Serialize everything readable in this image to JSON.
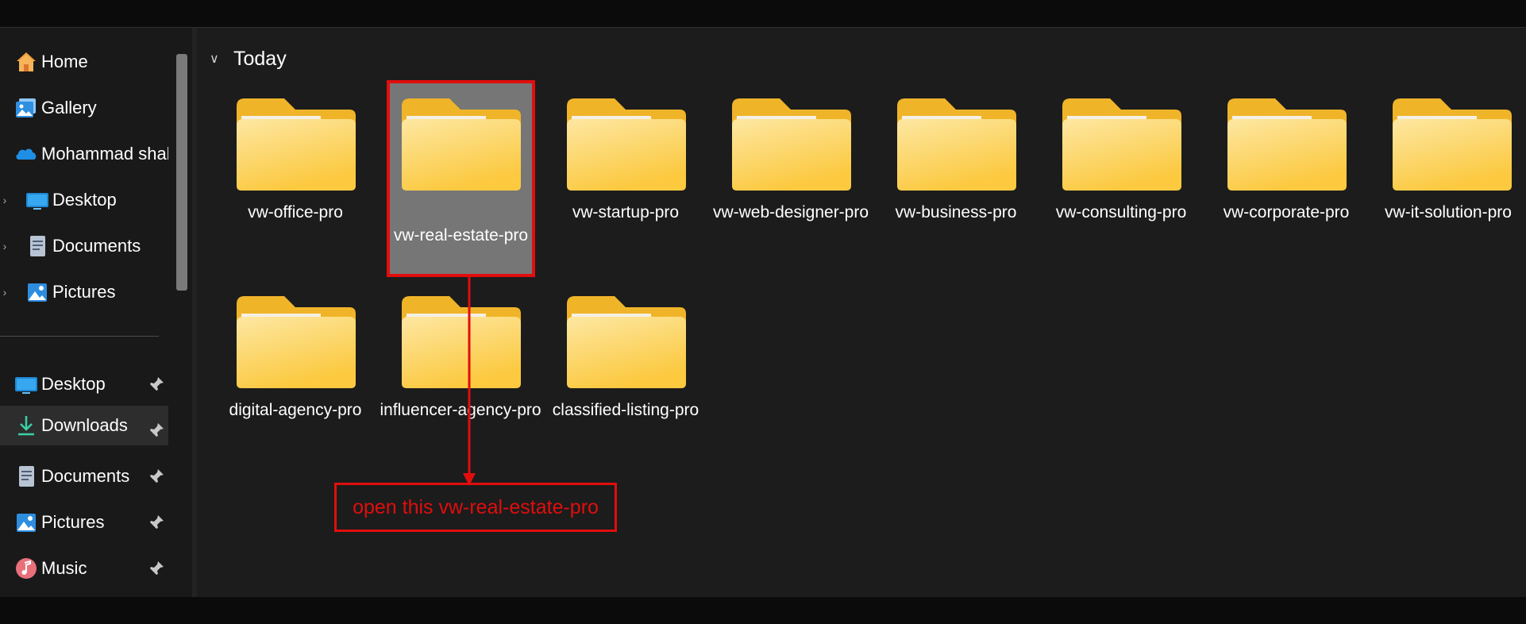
{
  "sidebar": {
    "items": [
      {
        "label": "Home",
        "icon": "home-icon",
        "selected": false,
        "pinned": false,
        "expandable": false
      },
      {
        "label": "Gallery",
        "icon": "gallery-icon",
        "selected": false,
        "pinned": false,
        "expandable": false
      },
      {
        "label": "Mohammad shal",
        "icon": "onedrive-icon",
        "selected": false,
        "pinned": false,
        "expandable": false
      },
      {
        "label": "Desktop",
        "icon": "desktop-icon",
        "selected": false,
        "pinned": false,
        "expandable": true
      },
      {
        "label": "Documents",
        "icon": "documents-icon",
        "selected": false,
        "pinned": false,
        "expandable": true
      },
      {
        "label": "Pictures",
        "icon": "pictures-icon",
        "selected": false,
        "pinned": false,
        "expandable": true
      },
      {
        "label": "Desktop",
        "icon": "desktop-icon",
        "selected": false,
        "pinned": true,
        "expandable": false
      },
      {
        "label": "Downloads",
        "icon": "downloads-icon",
        "selected": true,
        "pinned": true,
        "expandable": false
      },
      {
        "label": "Documents",
        "icon": "documents-icon",
        "selected": false,
        "pinned": true,
        "expandable": false
      },
      {
        "label": "Pictures",
        "icon": "pictures-icon",
        "selected": false,
        "pinned": true,
        "expandable": false
      },
      {
        "label": "Music",
        "icon": "music-icon",
        "selected": false,
        "pinned": true,
        "expandable": false
      }
    ]
  },
  "main": {
    "group_label": "Today",
    "folders": [
      {
        "name": "vw-office-pro",
        "selected": false
      },
      {
        "name": "vw-real-estate-pro",
        "selected": true
      },
      {
        "name": "vw-startup-pro",
        "selected": false
      },
      {
        "name": "vw-web-designer-pro",
        "selected": false
      },
      {
        "name": "vw-business-pro",
        "selected": false
      },
      {
        "name": "vw-consulting-pro",
        "selected": false
      },
      {
        "name": "vw-corporate-pro",
        "selected": false
      },
      {
        "name": "vw-it-solution-pro",
        "selected": false
      },
      {
        "name": "digital-agency-pro",
        "selected": false
      },
      {
        "name": "influencer-agency-pro",
        "selected": false
      },
      {
        "name": "classified-listing-pro",
        "selected": false
      }
    ]
  },
  "annotation": {
    "text": "open this vw-real-estate-pro",
    "color": "#e10d0d"
  },
  "colors": {
    "folder_back": "#f0b429",
    "folder_front": "#fcd462",
    "selection_border": "#e10d0d",
    "selection_fill": "#767676"
  }
}
